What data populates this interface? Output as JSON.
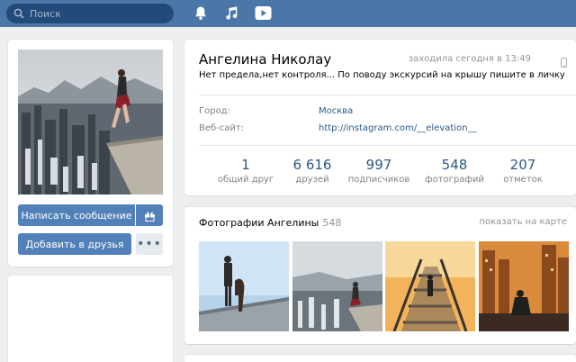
{
  "header": {
    "search_placeholder": "Поиск"
  },
  "profile": {
    "name": "Ангелина Николау",
    "online_status": "заходила сегодня в 13:49",
    "status_text": "Нет предела,нет контроля... По поводу экскурсий на крышу пишите в личку",
    "info": [
      {
        "label": "Город:",
        "value": "Москва"
      },
      {
        "label": "Веб-сайт:",
        "value": "http://instagram.com/__elevation__"
      }
    ],
    "counters": [
      {
        "num": "1",
        "label": "общий друг"
      },
      {
        "num": "6 616",
        "label": "друзей"
      },
      {
        "num": "997",
        "label": "подписчиков"
      },
      {
        "num": "548",
        "label": "фотографий"
      },
      {
        "num": "207",
        "label": "отметок"
      }
    ]
  },
  "actions": {
    "message_label": "Написать сообщение",
    "add_friend_label": "Добавить в друзья",
    "more_label": "•••"
  },
  "photos": {
    "title": "Фотографии Ангелины",
    "count": "548",
    "show_on_map": "показать на карте"
  },
  "colors": {
    "header_bg": "#4a76a8",
    "button_primary": "#5181b8",
    "link": "#2a5885"
  }
}
